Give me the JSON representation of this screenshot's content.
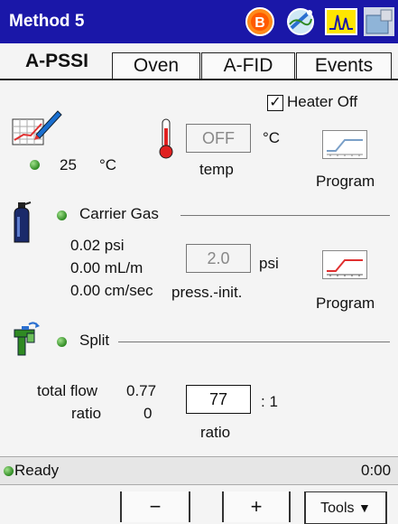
{
  "titlebar": {
    "title": "Method 5",
    "icons": [
      "power-icon",
      "gc-status-icon",
      "chromatogram-icon",
      "instrument-icon"
    ]
  },
  "tabs": [
    {
      "label": "A-PSSI",
      "active": true
    },
    {
      "label": "Oven",
      "active": false
    },
    {
      "label": "A-FID",
      "active": false
    },
    {
      "label": "Events",
      "active": false
    }
  ],
  "heater": {
    "checkbox_checked": true,
    "checkbox_label": "Heater Off",
    "current_temp": "25",
    "current_unit": "°C",
    "setpoint_value": "OFF",
    "setpoint_unit": "°C",
    "setpoint_label": "temp",
    "program_label": "Program",
    "status_color": "#2f8a23"
  },
  "carrier": {
    "label": "Carrier Gas",
    "pressure": "0.02 psi",
    "flow": "0.00 mL/m",
    "velocity": "0.00 cm/sec",
    "setpoint_value": "2.0",
    "setpoint_unit": "psi",
    "setpoint_label": "press.-init.",
    "program_label": "Program"
  },
  "split": {
    "label": "Split",
    "total_flow_label": "total flow",
    "total_flow_value": "0.77",
    "ratio_label": "ratio",
    "ratio_value": "0",
    "ratio_input_value": "77",
    "ratio_suffix": ": 1",
    "ratio_input_label": "ratio"
  },
  "status": {
    "text": "Ready",
    "time": "0:00"
  },
  "footer": {
    "minus": "−",
    "plus": "+",
    "tools": "Tools"
  }
}
